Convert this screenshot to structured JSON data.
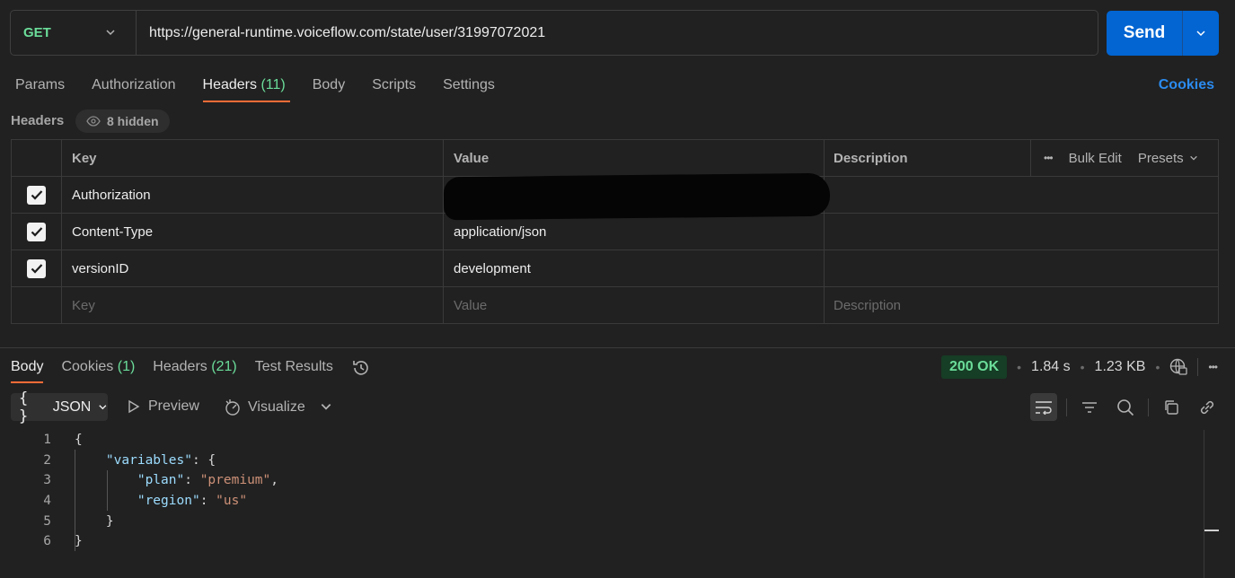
{
  "request": {
    "method": "GET",
    "url": "https://general-runtime.voiceflow.com/state/user/31997072021",
    "send_label": "Send"
  },
  "request_tabs": [
    {
      "label": "Params"
    },
    {
      "label": "Authorization"
    },
    {
      "label": "Headers",
      "count": "(11)",
      "active": true
    },
    {
      "label": "Body"
    },
    {
      "label": "Scripts"
    },
    {
      "label": "Settings"
    }
  ],
  "cookies_link": "Cookies",
  "headers_section": {
    "label": "Headers",
    "hidden_label": "8 hidden",
    "columns": {
      "key": "Key",
      "value": "Value",
      "description": "Description"
    },
    "bulk_edit": "Bulk Edit",
    "presets": "Presets",
    "rows": [
      {
        "key": "Authorization",
        "value": "",
        "checked": true,
        "redacted": true
      },
      {
        "key": "Content-Type",
        "value": "application/json",
        "checked": true
      },
      {
        "key": "versionID",
        "value": "development",
        "checked": true
      }
    ],
    "placeholders": {
      "key": "Key",
      "value": "Value",
      "description": "Description"
    }
  },
  "response_tabs": [
    {
      "label": "Body",
      "active": true
    },
    {
      "label": "Cookies",
      "count": "(1)"
    },
    {
      "label": "Headers",
      "count": "(21)"
    },
    {
      "label": "Test Results"
    }
  ],
  "response_status": {
    "status": "200 OK",
    "time": "1.84 s",
    "size": "1.23 KB"
  },
  "response_toolbar": {
    "format": "JSON",
    "preview": "Preview",
    "visualize": "Visualize"
  },
  "code_lines": [
    {
      "n": "1"
    },
    {
      "n": "2"
    },
    {
      "n": "3"
    },
    {
      "n": "4"
    },
    {
      "n": "5"
    },
    {
      "n": "6"
    }
  ],
  "body_json": {
    "variables_key": "\"variables\"",
    "plan_key": "\"plan\"",
    "plan_value": "\"premium\"",
    "region_key": "\"region\"",
    "region_value": "\"us\""
  },
  "colors": {
    "accent_orange": "#ff6c37",
    "send_blue": "#0265d2",
    "method_green": "#6bdd9a",
    "link_blue": "#2b8bf0"
  }
}
